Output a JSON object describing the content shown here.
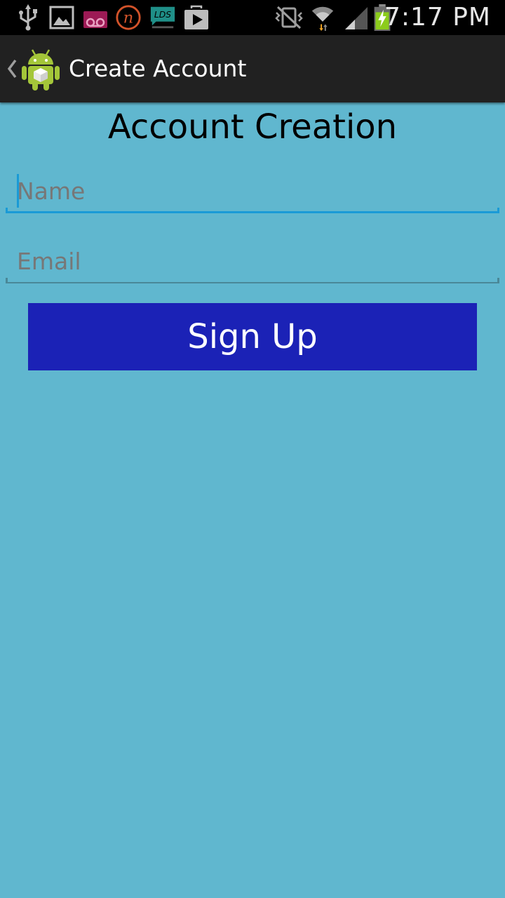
{
  "status_bar": {
    "time": "7:17 PM",
    "notification_icons": [
      "usb-icon",
      "gallery-icon",
      "voicemail-icon",
      "n-app-icon",
      "lds-chat-icon",
      "play-store-icon"
    ],
    "system_icons": [
      "vibrate-icon",
      "wifi-icon",
      "signal-icon",
      "battery-charging-icon"
    ],
    "lds_badge_text": "LDS"
  },
  "action_bar": {
    "title": "Create Account",
    "app_icon": "android-robot-icon"
  },
  "content": {
    "heading": "Account Creation",
    "name_field": {
      "placeholder": "Name",
      "value": ""
    },
    "email_field": {
      "placeholder": "Email",
      "value": ""
    },
    "signup_label": "Sign Up"
  },
  "colors": {
    "background": "#60b7cf",
    "action_bar": "#212121",
    "focused_underline": "#1a9ad6",
    "button": "#1b22b6"
  }
}
